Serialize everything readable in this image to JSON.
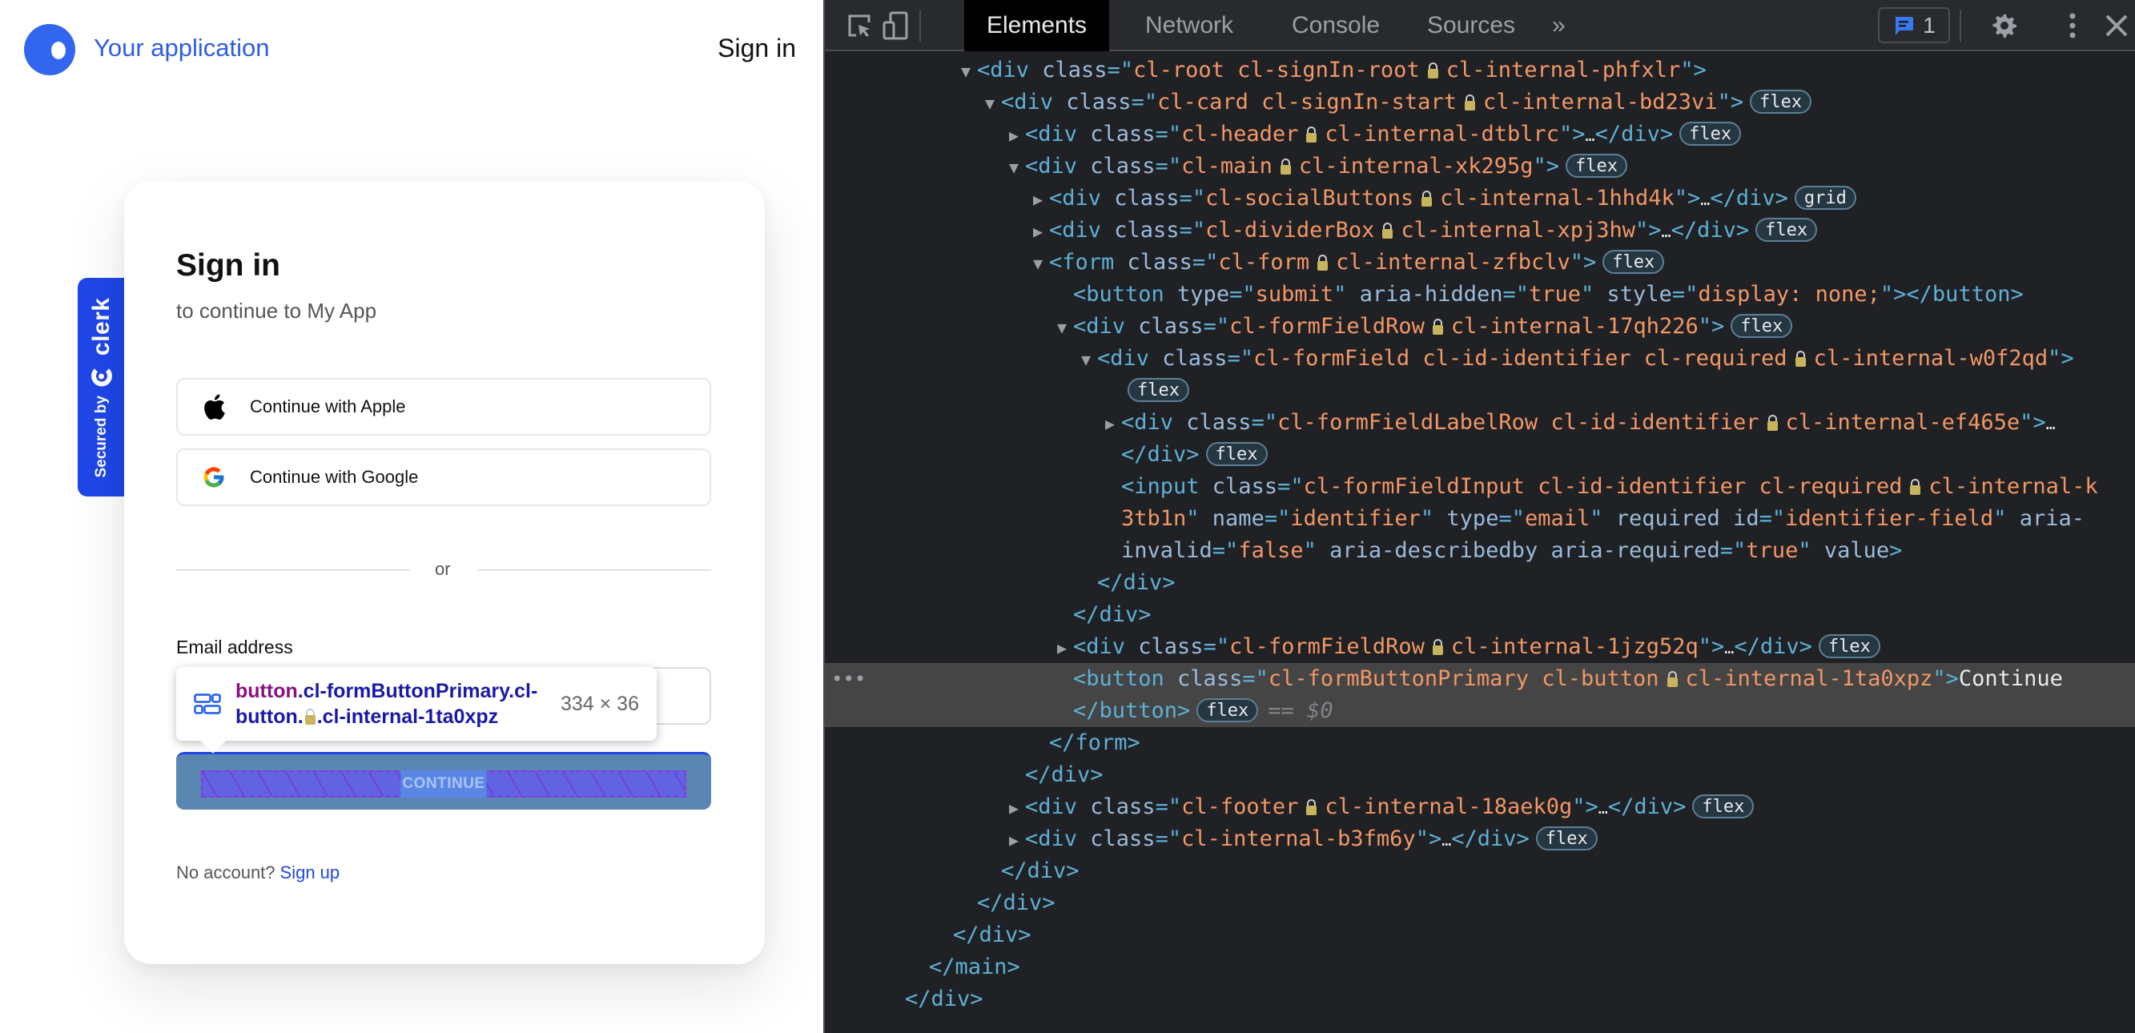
{
  "app": {
    "brand_name": "Your application",
    "header_signin": "Sign in",
    "colors": {
      "brand": "#2e5ce6",
      "clerk_blue": "#1f46e8"
    }
  },
  "badge": {
    "secured_by": "Secured by",
    "brand": "clerk"
  },
  "card": {
    "title": "Sign in",
    "subtitle": "to continue to My App",
    "social": [
      {
        "icon": "apple-icon",
        "label": "Continue with Apple"
      },
      {
        "icon": "google-icon",
        "label": "Continue with Google"
      }
    ],
    "divider": "or",
    "email_label": "Email address",
    "email_value": "",
    "primary_button": "CONTINUE",
    "footer_text": "No account?",
    "footer_link": "Sign up"
  },
  "inspect_tooltip": {
    "tag": "button",
    "selector_line1": ".cl-formButtonPrimary.cl-",
    "selector_line2": "button.",
    "selector_line2_tail": ".cl-internal-1ta0xpz",
    "size": "334 × 36"
  },
  "devtools": {
    "tabs": [
      "Elements",
      "Network",
      "Console",
      "Sources"
    ],
    "active_tab": "Elements",
    "more_tabs": "»",
    "issues_count": "1",
    "selected_suffix": "== $0",
    "lines": [
      {
        "indent": 0,
        "tri": "▼",
        "parts": [
          [
            "tg",
            "<div "
          ],
          [
            "an",
            "class"
          ],
          [
            "tg",
            "=\""
          ],
          [
            "av",
            "cl-root cl-signIn-root"
          ],
          [
            "lock",
            ""
          ],
          [
            "av",
            "cl-internal-phfxlr"
          ],
          [
            "tg",
            "\">"
          ]
        ]
      },
      {
        "indent": 1,
        "tri": "▼",
        "parts": [
          [
            "tg",
            "<div "
          ],
          [
            "an",
            "class"
          ],
          [
            "tg",
            "=\""
          ],
          [
            "av",
            "cl-card cl-signIn-start"
          ],
          [
            "lock",
            ""
          ],
          [
            "av",
            "cl-internal-bd23vi"
          ],
          [
            "tg",
            "\">"
          ],
          [
            "pill",
            "flex"
          ]
        ]
      },
      {
        "indent": 2,
        "tri": "▶",
        "parts": [
          [
            "tg",
            "<div "
          ],
          [
            "an",
            "class"
          ],
          [
            "tg",
            "=\""
          ],
          [
            "av",
            "cl-header"
          ],
          [
            "lock",
            ""
          ],
          [
            "av",
            "cl-internal-dtblrc"
          ],
          [
            "tg",
            "\">"
          ],
          [
            "ell",
            "…"
          ],
          [
            "tg",
            "</div>"
          ],
          [
            "pill",
            "flex"
          ]
        ]
      },
      {
        "indent": 2,
        "tri": "▼",
        "parts": [
          [
            "tg",
            "<div "
          ],
          [
            "an",
            "class"
          ],
          [
            "tg",
            "=\""
          ],
          [
            "av",
            "cl-main"
          ],
          [
            "lock",
            ""
          ],
          [
            "av",
            "cl-internal-xk295g"
          ],
          [
            "tg",
            "\">"
          ],
          [
            "pill",
            "flex"
          ]
        ]
      },
      {
        "indent": 3,
        "tri": "▶",
        "parts": [
          [
            "tg",
            "<div "
          ],
          [
            "an",
            "class"
          ],
          [
            "tg",
            "=\""
          ],
          [
            "av",
            "cl-socialButtons"
          ],
          [
            "lock",
            ""
          ],
          [
            "av",
            "cl-internal-1hhd4k"
          ],
          [
            "tg",
            "\">"
          ],
          [
            "ell",
            "…"
          ],
          [
            "tg",
            "</div>"
          ],
          [
            "pill",
            "grid"
          ]
        ]
      },
      {
        "indent": 3,
        "tri": "▶",
        "parts": [
          [
            "tg",
            "<div "
          ],
          [
            "an",
            "class"
          ],
          [
            "tg",
            "=\""
          ],
          [
            "av",
            "cl-dividerBox"
          ],
          [
            "lock",
            ""
          ],
          [
            "av",
            "cl-internal-xpj3hw"
          ],
          [
            "tg",
            "\">"
          ],
          [
            "ell",
            "…"
          ],
          [
            "tg",
            "</div>"
          ],
          [
            "pill",
            "flex"
          ]
        ]
      },
      {
        "indent": 3,
        "tri": "▼",
        "parts": [
          [
            "tg",
            "<form "
          ],
          [
            "an",
            "class"
          ],
          [
            "tg",
            "=\""
          ],
          [
            "av",
            "cl-form"
          ],
          [
            "lock",
            ""
          ],
          [
            "av",
            "cl-internal-zfbclv"
          ],
          [
            "tg",
            "\">"
          ],
          [
            "pill",
            "flex"
          ]
        ]
      },
      {
        "indent": 4,
        "tri": "",
        "parts": [
          [
            "tg",
            "<button "
          ],
          [
            "an",
            "type"
          ],
          [
            "tg",
            "=\""
          ],
          [
            "av",
            "submit"
          ],
          [
            "tg",
            "\" "
          ],
          [
            "an",
            "aria-hidden"
          ],
          [
            "tg",
            "=\""
          ],
          [
            "av",
            "true"
          ],
          [
            "tg",
            "\" "
          ],
          [
            "an",
            "style"
          ],
          [
            "tg",
            "=\""
          ],
          [
            "av",
            "display: none;"
          ],
          [
            "tg",
            "\"></button>"
          ]
        ]
      },
      {
        "indent": 4,
        "tri": "▼",
        "parts": [
          [
            "tg",
            "<div "
          ],
          [
            "an",
            "class"
          ],
          [
            "tg",
            "=\""
          ],
          [
            "av",
            "cl-formFieldRow"
          ],
          [
            "lock",
            ""
          ],
          [
            "av",
            "cl-internal-17qh226"
          ],
          [
            "tg",
            "\">"
          ],
          [
            "pill",
            "flex"
          ]
        ]
      },
      {
        "indent": 5,
        "tri": "▼",
        "parts": [
          [
            "tg",
            "<div "
          ],
          [
            "an",
            "class"
          ],
          [
            "tg",
            "=\""
          ],
          [
            "av",
            "cl-formField cl-id-identifier cl-required"
          ],
          [
            "lock",
            ""
          ],
          [
            "av",
            "cl-internal-w0f2qd"
          ],
          [
            "tg",
            "\">"
          ]
        ]
      },
      {
        "indent": 6,
        "tri": "",
        "parts": [
          [
            "pill",
            "flex"
          ]
        ]
      },
      {
        "indent": 6,
        "tri": "▶",
        "parts": [
          [
            "tg",
            "<div "
          ],
          [
            "an",
            "class"
          ],
          [
            "tg",
            "=\""
          ],
          [
            "av",
            "cl-formFieldLabelRow cl-id-identifier"
          ],
          [
            "lock",
            ""
          ],
          [
            "av",
            "cl-internal-ef465e"
          ],
          [
            "tg",
            "\">"
          ],
          [
            "ell",
            "…"
          ]
        ]
      },
      {
        "indent": 6,
        "tri": "",
        "parts": [
          [
            "tg",
            "</div>"
          ],
          [
            "pill",
            "flex"
          ]
        ]
      },
      {
        "indent": 6,
        "tri": "",
        "parts": [
          [
            "tg",
            "<input "
          ],
          [
            "an",
            "class"
          ],
          [
            "tg",
            "=\""
          ],
          [
            "av",
            "cl-formFieldInput cl-id-identifier cl-required"
          ],
          [
            "lock",
            ""
          ],
          [
            "av",
            "cl-internal-k"
          ]
        ]
      },
      {
        "indent": 6,
        "tri": "",
        "parts": [
          [
            "av",
            "3tb1n"
          ],
          [
            "tg",
            "\" "
          ],
          [
            "an",
            "name"
          ],
          [
            "tg",
            "=\""
          ],
          [
            "av",
            "identifier"
          ],
          [
            "tg",
            "\" "
          ],
          [
            "an",
            "type"
          ],
          [
            "tg",
            "=\""
          ],
          [
            "av",
            "email"
          ],
          [
            "tg",
            "\" "
          ],
          [
            "an",
            "required id"
          ],
          [
            "tg",
            "=\""
          ],
          [
            "av",
            "identifier-field"
          ],
          [
            "tg",
            "\" "
          ],
          [
            "an",
            "aria-"
          ]
        ]
      },
      {
        "indent": 6,
        "tri": "",
        "parts": [
          [
            "an",
            "invalid"
          ],
          [
            "tg",
            "=\""
          ],
          [
            "av",
            "false"
          ],
          [
            "tg",
            "\" "
          ],
          [
            "an",
            "aria-describedby aria-required"
          ],
          [
            "tg",
            "=\""
          ],
          [
            "av",
            "true"
          ],
          [
            "tg",
            "\" "
          ],
          [
            "an",
            "value"
          ],
          [
            "tg",
            ">"
          ]
        ]
      },
      {
        "indent": 5,
        "tri": "",
        "parts": [
          [
            "tg",
            "</div>"
          ]
        ]
      },
      {
        "indent": 4,
        "tri": "",
        "parts": [
          [
            "tg",
            "</div>"
          ]
        ]
      },
      {
        "indent": 4,
        "tri": "▶",
        "parts": [
          [
            "tg",
            "<div "
          ],
          [
            "an",
            "class"
          ],
          [
            "tg",
            "=\""
          ],
          [
            "av",
            "cl-formFieldRow"
          ],
          [
            "lock",
            ""
          ],
          [
            "av",
            "cl-internal-1jzg52q"
          ],
          [
            "tg",
            "\">"
          ],
          [
            "ell",
            "…"
          ],
          [
            "tg",
            "</div>"
          ],
          [
            "pill",
            "flex"
          ]
        ]
      },
      {
        "indent": 4,
        "tri": "",
        "selected": true,
        "parts": [
          [
            "tg",
            "<button "
          ],
          [
            "an",
            "class"
          ],
          [
            "tg",
            "=\""
          ],
          [
            "av",
            "cl-formButtonPrimary cl-button"
          ],
          [
            "lock",
            ""
          ],
          [
            "av",
            "cl-internal-1ta0xpz"
          ],
          [
            "tg",
            "\">"
          ],
          [
            "tx",
            "Continue"
          ]
        ]
      },
      {
        "indent": 4,
        "tri": "",
        "selected": true,
        "parts": [
          [
            "tg",
            "</button>"
          ],
          [
            "pill",
            "flex"
          ],
          [
            "dollar",
            "== $0"
          ]
        ]
      },
      {
        "indent": 3,
        "tri": "",
        "parts": [
          [
            "tg",
            "</form>"
          ]
        ]
      },
      {
        "indent": 2,
        "tri": "",
        "parts": [
          [
            "tg",
            "</div>"
          ]
        ]
      },
      {
        "indent": 2,
        "tri": "▶",
        "parts": [
          [
            "tg",
            "<div "
          ],
          [
            "an",
            "class"
          ],
          [
            "tg",
            "=\""
          ],
          [
            "av",
            "cl-footer"
          ],
          [
            "lock",
            ""
          ],
          [
            "av",
            "cl-internal-18aek0g"
          ],
          [
            "tg",
            "\">"
          ],
          [
            "ell",
            "…"
          ],
          [
            "tg",
            "</div>"
          ],
          [
            "pill",
            "flex"
          ]
        ]
      },
      {
        "indent": 2,
        "tri": "▶",
        "parts": [
          [
            "tg",
            "<div "
          ],
          [
            "an",
            "class"
          ],
          [
            "tg",
            "=\""
          ],
          [
            "av",
            "cl-internal-b3fm6y"
          ],
          [
            "tg",
            "\">"
          ],
          [
            "ell",
            "…"
          ],
          [
            "tg",
            "</div>"
          ],
          [
            "pill",
            "flex"
          ]
        ]
      },
      {
        "indent": 1,
        "tri": "",
        "parts": [
          [
            "tg",
            "</div>"
          ]
        ]
      },
      {
        "indent": 0,
        "tri": "",
        "parts": [
          [
            "tg",
            "</div>"
          ]
        ]
      },
      {
        "indent": -1,
        "tri": "",
        "parts": [
          [
            "tg",
            "</div>"
          ]
        ]
      },
      {
        "indent": -2,
        "tri": "",
        "parts": [
          [
            "tg",
            "</main>"
          ]
        ]
      },
      {
        "indent": -3,
        "tri": "",
        "parts": [
          [
            "tg",
            "</div>"
          ]
        ]
      }
    ]
  }
}
